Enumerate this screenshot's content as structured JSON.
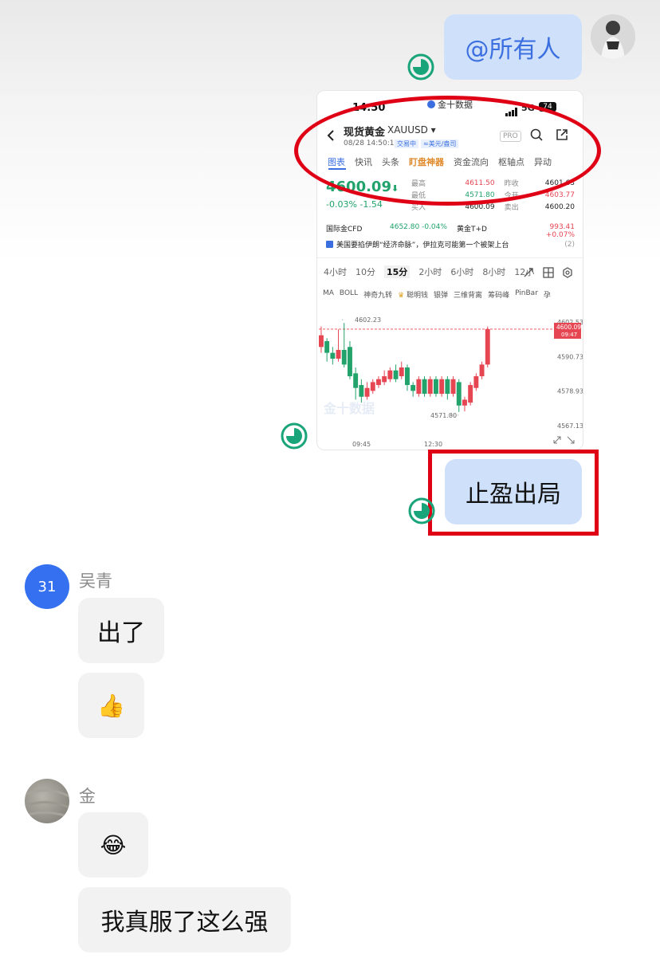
{
  "messages_self": {
    "m1": "@所有人",
    "m3": "止盈出局"
  },
  "user1": {
    "name": "吴青",
    "avatar_text": "31",
    "msg1": "出了",
    "msg2": "👍"
  },
  "user2": {
    "name": "金",
    "msg1": "😂",
    "msg2": "我真服了这么强"
  },
  "embedded": {
    "status_time": "14:50",
    "status_center": "金十数据",
    "status_signal": "5G",
    "status_battery": "74",
    "title": "现货黄金",
    "symbol": "XAUUSD ▾",
    "datetime": "08/28 14:50:13",
    "trade_status": "交易中",
    "currency": "≈美元/盎司",
    "pro": "PRO",
    "tabs": [
      "图表",
      "快讯",
      "头条",
      "盯盘神器",
      "资金流向",
      "枢轴点",
      "异动"
    ],
    "price": "4600.09",
    "price_arrow": "⬇",
    "change": "-0.03%  -1.54",
    "stats": [
      {
        "label": "最高",
        "value": "4611.50",
        "label2": "昨收",
        "value2": "4601.63"
      },
      {
        "label": "最低",
        "value": "4571.80",
        "label2": "今开",
        "value2": "4603.77"
      },
      {
        "label": "买入",
        "value": "4600.09",
        "label2": "卖出",
        "value2": "4600.20"
      }
    ],
    "related1_name": "国际金CFD",
    "related1_val": "4652.80  -0.04%",
    "related2_name": "黄金T+D",
    "related2_val": "993.41  +0.07%",
    "news": "美国要掐伊朗“经济命脉”，伊拉克可能第一个被架上台",
    "news_count": "(2)",
    "periods": [
      "4小时",
      "10分",
      "15分",
      "2小时",
      "6小时",
      "8小时",
      "12小"
    ],
    "indicators": [
      "MA",
      "BOLL",
      "神奇九转",
      "聪明钱",
      "银弹",
      "三维背离",
      "筹码峰",
      "PinBar",
      "孕"
    ],
    "high_label": "4602.23",
    "low_label": "4571.80",
    "y_ticks": [
      "4602.53",
      "4590.73",
      "4578.93",
      "4567.13"
    ],
    "current_price": "4600.09",
    "countdown": "09:47",
    "x_ticks": [
      "09:45",
      "12:30"
    ],
    "watermark": "金十数据"
  },
  "chart_data": {
    "type": "candlestick",
    "y_range": [
      4567.13,
      4602.53
    ],
    "x_ticks": [
      "09:45",
      "12:30"
    ],
    "high": 4602.23,
    "low": 4571.8,
    "last": 4600.09,
    "candles": [
      {
        "o": 4594,
        "c": 4598,
        "h": 4601,
        "l": 4592
      },
      {
        "o": 4596,
        "c": 4592,
        "h": 4597,
        "l": 4589
      },
      {
        "o": 4592,
        "c": 4590,
        "h": 4594,
        "l": 4588
      },
      {
        "o": 4590,
        "c": 4593,
        "h": 4600,
        "l": 4589
      },
      {
        "o": 4593,
        "c": 4588,
        "h": 4602.23,
        "l": 4587
      },
      {
        "o": 4594,
        "c": 4584,
        "h": 4596,
        "l": 4583
      },
      {
        "o": 4585,
        "c": 4580,
        "h": 4587,
        "l": 4576
      },
      {
        "o": 4581,
        "c": 4577,
        "h": 4583,
        "l": 4575
      },
      {
        "o": 4577,
        "c": 4580,
        "h": 4582,
        "l": 4576
      },
      {
        "o": 4579,
        "c": 4582,
        "h": 4583,
        "l": 4578
      },
      {
        "o": 4581,
        "c": 4583,
        "h": 4584,
        "l": 4580
      },
      {
        "o": 4582,
        "c": 4584,
        "h": 4586,
        "l": 4581
      },
      {
        "o": 4583,
        "c": 4586,
        "h": 4587,
        "l": 4582
      },
      {
        "o": 4586,
        "c": 4583,
        "h": 4588,
        "l": 4582
      },
      {
        "o": 4584,
        "c": 4587,
        "h": 4589,
        "l": 4583
      },
      {
        "o": 4587,
        "c": 4581,
        "h": 4588,
        "l": 4579
      },
      {
        "o": 4581,
        "c": 4579,
        "h": 4582,
        "l": 4577
      },
      {
        "o": 4578,
        "c": 4583,
        "h": 4584,
        "l": 4577
      },
      {
        "o": 4583,
        "c": 4578,
        "h": 4584,
        "l": 4577
      },
      {
        "o": 4578,
        "c": 4583,
        "h": 4584,
        "l": 4577
      },
      {
        "o": 4583,
        "c": 4578,
        "h": 4584,
        "l": 4577
      },
      {
        "o": 4578,
        "c": 4583,
        "h": 4584,
        "l": 4577
      },
      {
        "o": 4583,
        "c": 4578,
        "h": 4584,
        "l": 4576
      },
      {
        "o": 4578,
        "c": 4583,
        "h": 4584,
        "l": 4577
      },
      {
        "o": 4582,
        "c": 4574,
        "h": 4583,
        "l": 4571.8
      },
      {
        "o": 4574,
        "c": 4576,
        "h": 4577,
        "l": 4572
      },
      {
        "o": 4575,
        "c": 4581,
        "h": 4582,
        "l": 4574
      },
      {
        "o": 4580,
        "c": 4584,
        "h": 4585,
        "l": 4579
      },
      {
        "o": 4584,
        "c": 4588,
        "h": 4589,
        "l": 4583
      },
      {
        "o": 4588,
        "c": 4600.09,
        "h": 4601,
        "l": 4587
      }
    ]
  },
  "colors": {
    "up": "#e64552",
    "down": "#21a36b",
    "bubble_self": "#cfe0fb",
    "annotation": "#e00016",
    "accent": "#3b6fe0"
  }
}
